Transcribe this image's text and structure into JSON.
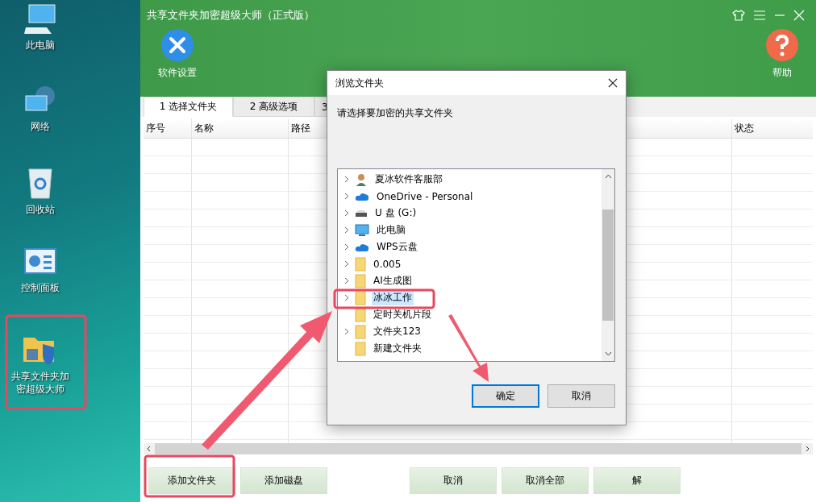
{
  "desktop": {
    "icons": [
      {
        "label": "此电脑",
        "kind": "computer"
      },
      {
        "label": "网络",
        "kind": "network"
      },
      {
        "label": "回收站",
        "kind": "recycle"
      },
      {
        "label": "控制面板",
        "kind": "control"
      },
      {
        "label": "共享文件夹加密超级大师",
        "kind": "app"
      }
    ]
  },
  "app": {
    "title": "共享文件夹加密超级大师（正式版）",
    "toolbar": [
      {
        "label": "软件设置",
        "kind": "settings"
      },
      {
        "label": "帮助",
        "kind": "help"
      }
    ],
    "tabs": [
      {
        "label": "1 选择文件夹",
        "selected": true
      },
      {
        "label": "2 高级选项",
        "selected": false
      },
      {
        "label": "3",
        "selected": false
      }
    ],
    "table": {
      "columns": [
        "序号",
        "名称",
        "路径",
        "状态"
      ]
    },
    "buttons": [
      "添加文件夹",
      "添加磁盘",
      "取消",
      "取消全部",
      "解"
    ]
  },
  "dialog": {
    "title": "浏览文件夹",
    "prompt": "请选择要加密的共享文件夹",
    "tree": [
      {
        "label": "夏冰软件客服部",
        "kind": "user",
        "expandable": true,
        "selected": false
      },
      {
        "label": "OneDrive - Personal",
        "kind": "cloud",
        "expandable": true,
        "selected": false
      },
      {
        "label": "U 盘 (G:)",
        "kind": "drive",
        "expandable": true,
        "selected": false
      },
      {
        "label": "此电脑",
        "kind": "computer",
        "expandable": true,
        "selected": false
      },
      {
        "label": "WPS云盘",
        "kind": "cloud",
        "expandable": true,
        "selected": false
      },
      {
        "label": "0.005",
        "kind": "folder",
        "expandable": true,
        "selected": false
      },
      {
        "label": "AI生成图",
        "kind": "folder",
        "expandable": true,
        "selected": false
      },
      {
        "label": "冰冰工作",
        "kind": "folder",
        "expandable": true,
        "selected": true
      },
      {
        "label": "定时关机片段",
        "kind": "folder",
        "expandable": false,
        "selected": false
      },
      {
        "label": "文件夹123",
        "kind": "folder",
        "expandable": true,
        "selected": false
      },
      {
        "label": "新建文件夹",
        "kind": "folder",
        "expandable": false,
        "selected": false
      }
    ],
    "buttons": [
      {
        "label": "确定",
        "default": true
      },
      {
        "label": "取消",
        "default": false
      }
    ]
  }
}
